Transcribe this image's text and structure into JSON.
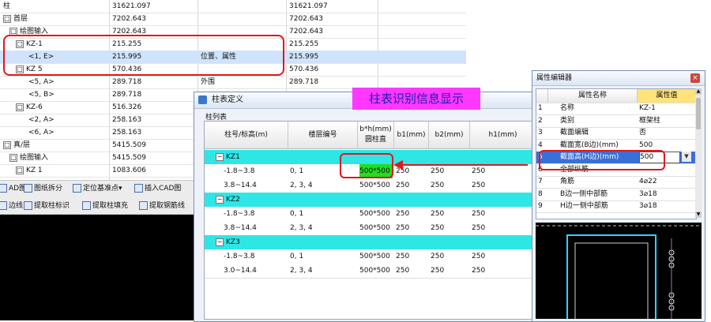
{
  "tree_rows": [
    {
      "label": "柱",
      "indent": 0,
      "box": "",
      "qty": "31621.097",
      "desc": "",
      "total": "31621.097",
      "selected": false
    },
    {
      "label": "首层",
      "indent": 0,
      "box": "□",
      "qty": "7202.643",
      "desc": "",
      "total": "7202.643",
      "selected": false
    },
    {
      "label": "绘图输入",
      "indent": 1,
      "box": "□",
      "qty": "7202.643",
      "desc": "",
      "total": "7202.643",
      "selected": false
    },
    {
      "label": "KZ-1",
      "indent": 2,
      "box": "□",
      "qty": "215.255",
      "desc": "",
      "total": "215.255",
      "selected": false
    },
    {
      "label": "<1, E>",
      "indent": 4,
      "box": "",
      "qty": "215.995",
      "desc": "位置、属性",
      "total": "215.995",
      "selected": true
    },
    {
      "label": "KZ 5",
      "indent": 2,
      "box": "□",
      "qty": "570.436",
      "desc": "",
      "total": "570.436",
      "selected": false
    },
    {
      "label": "<5, A>",
      "indent": 4,
      "box": "",
      "qty": "289.718",
      "desc": "外围",
      "total": "289.718",
      "selected": false
    },
    {
      "label": "<5, B>",
      "indent": 4,
      "box": "",
      "qty": "289.718",
      "desc": "",
      "total": "",
      "selected": false
    },
    {
      "label": "KZ-6",
      "indent": 2,
      "box": "□",
      "qty": "516.326",
      "desc": "",
      "total": "",
      "selected": false
    },
    {
      "label": "<2, A>",
      "indent": 4,
      "box": "",
      "qty": "258.163",
      "desc": "",
      "total": "",
      "selected": false
    },
    {
      "label": "<6, A>",
      "indent": 4,
      "box": "",
      "qty": "258.163",
      "desc": "",
      "total": "",
      "selected": false
    },
    {
      "label": "真/层",
      "indent": 0,
      "box": "□",
      "qty": "5415.509",
      "desc": "",
      "total": "",
      "selected": false
    },
    {
      "label": "绘图输入",
      "indent": 1,
      "box": "□",
      "qty": "5415.509",
      "desc": "",
      "total": "",
      "selected": false
    },
    {
      "label": "KZ 1",
      "indent": 2,
      "box": "□",
      "qty": "1083.606",
      "desc": "",
      "total": "",
      "selected": false
    }
  ],
  "toolbar1": [
    {
      "label": "AD图",
      "icon": "cad-icon"
    },
    {
      "label": "图纸拆分",
      "icon": "split-drawing-icon"
    },
    {
      "label": "定位基准点▾",
      "icon": "locate-point-icon"
    },
    {
      "label": "插入CAD图",
      "icon": "insert-cad-icon"
    }
  ],
  "toolbar2": [
    {
      "label": "边线",
      "icon": "edge-line-icon"
    },
    {
      "label": "提取柱标识",
      "icon": "extract-column-id-icon"
    },
    {
      "label": "提取柱填充",
      "icon": "extract-column-fill-icon"
    },
    {
      "label": "提取钢筋线",
      "icon": "extract-rebar-icon"
    }
  ],
  "dialog": {
    "title": "柱表定义",
    "list_label": "柱列表",
    "headers": [
      "柱号/标高(m)",
      "楼层编号",
      "b*h(mm)\n圆柱直",
      "b1(mm)",
      "b2(mm)",
      "h1(mm)"
    ],
    "groups": [
      {
        "name": "KZ1",
        "rows": [
          {
            "elev": "-1.8~3.8",
            "floors": "0, 1",
            "bh": "500*500",
            "b1": "250",
            "b2": "250",
            "h1": "250",
            "highlight": true
          },
          {
            "elev": "3.8~14.4",
            "floors": "2, 3, 4",
            "bh": "500*500",
            "b1": "250",
            "b2": "250",
            "h1": "250",
            "highlight": false
          }
        ]
      },
      {
        "name": "KZ2",
        "rows": [
          {
            "elev": "-1.8~3.8",
            "floors": "0, 1",
            "bh": "500*500",
            "b1": "250",
            "b2": "250",
            "h1": "250",
            "highlight": false
          },
          {
            "elev": "3.8~14.4",
            "floors": "2, 3, 4",
            "bh": "500*500",
            "b1": "250",
            "b2": "250",
            "h1": "250",
            "highlight": false
          }
        ]
      },
      {
        "name": "KZ3",
        "rows": [
          {
            "elev": "-1.8~3.8",
            "floors": "0, 1",
            "bh": "500*500",
            "b1": "250",
            "b2": "250",
            "h1": "250",
            "highlight": false
          },
          {
            "elev": "3.0~14.4",
            "floors": "2, 3, 4",
            "bh": "500*500",
            "b1": "250",
            "b2": "250",
            "h1": "250",
            "highlight": false
          }
        ]
      }
    ]
  },
  "annotation": {
    "label": "柱表识别信息显示"
  },
  "property_editor": {
    "title": "属性编辑器",
    "header_name": "属性名称",
    "header_value": "属性值",
    "rows": [
      {
        "num": "1",
        "name": "名称",
        "value": "KZ-1",
        "selected": false
      },
      {
        "num": "2",
        "name": "类别",
        "value": "框架柱",
        "selected": false
      },
      {
        "num": "3",
        "name": "截面编辑",
        "value": "否",
        "selected": false
      },
      {
        "num": "4",
        "name": "截面宽(B边)(mm)",
        "value": "500",
        "selected": false
      },
      {
        "num": "5",
        "name": "截面高(H边)(mm)",
        "value": "500",
        "selected": true
      },
      {
        "num": "6",
        "name": "全部纵筋",
        "value": "",
        "selected": false
      },
      {
        "num": "7",
        "name": "角筋",
        "value": "4⌀22",
        "selected": false
      },
      {
        "num": "8",
        "name": "B边一侧中部筋",
        "value": "3⌀18",
        "selected": false
      },
      {
        "num": "9",
        "name": "H边一侧中部筋",
        "value": "3⌀18",
        "selected": false
      }
    ]
  },
  "colors": {
    "group_row": "#2ee6e6",
    "highlight_cell": "#22dd22",
    "annotation_bg": "#ff37ff",
    "annotation_text": "#1c1fb0",
    "red_markup": "#e0181a",
    "selection_blue": "#3a6fd8"
  }
}
